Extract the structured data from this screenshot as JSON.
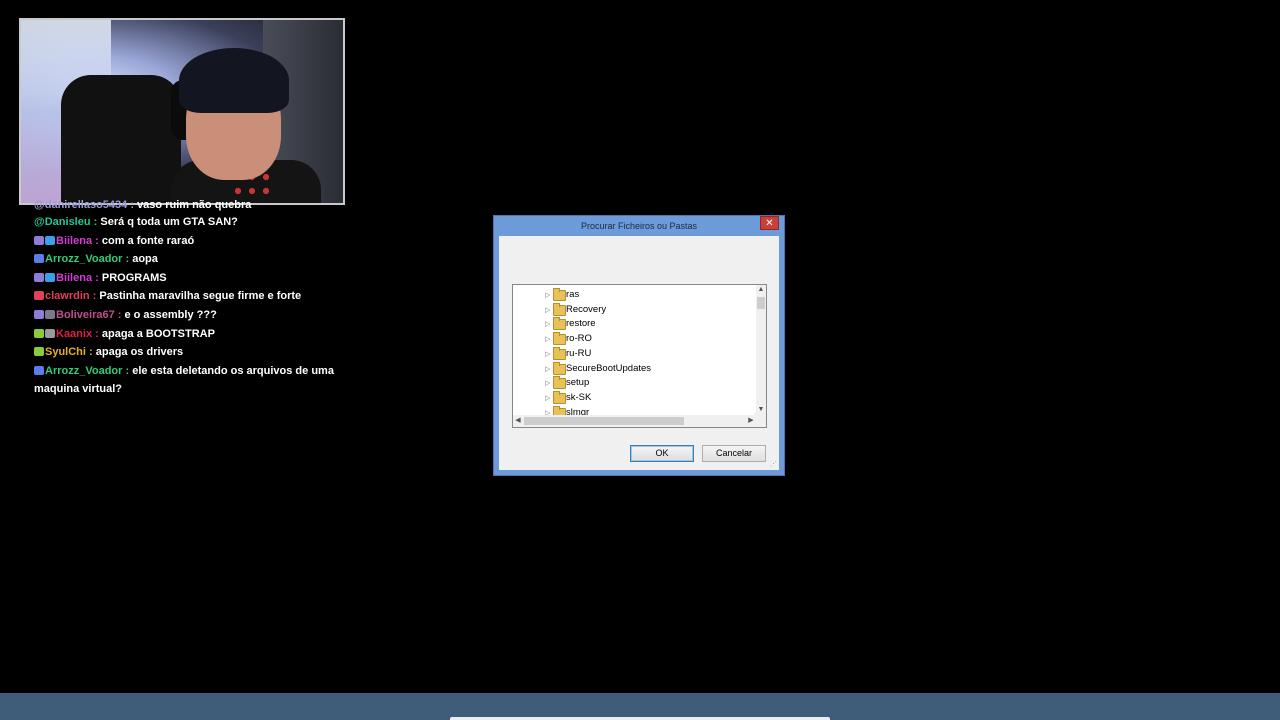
{
  "webcam": {
    "icon": "webcam-feed"
  },
  "chat": [
    {
      "user": "@danirellaso5434",
      "msg": "vaso ruim não quebra",
      "color": "#9b9bd6",
      "badges": []
    },
    {
      "user": "@Danisleu",
      "msg": "Será q toda um GTA SAN?",
      "color": "#20c997",
      "badges": []
    },
    {
      "user": "Biilena",
      "msg": "com a fonte raraó",
      "color": "#d13fd1",
      "badges": [
        "#8f7bd8",
        "#3aa0e8"
      ]
    },
    {
      "user": "Arrozz_Voador",
      "msg": "aopa",
      "color": "#33cc7a",
      "badges": [
        "#5f7be8"
      ]
    },
    {
      "user": "Biilena",
      "msg": "PROGRAMS",
      "color": "#d13fd1",
      "badges": [
        "#8f7bd8",
        "#3aa0e8"
      ]
    },
    {
      "user": "clawrdin",
      "msg": "Pastinha maravilha segue firme e forte",
      "color": "#e0405a",
      "badges": [
        "#e0405a"
      ]
    },
    {
      "user": "Boliveira67",
      "msg": "e o assembly ???",
      "color": "#c04f8c",
      "badges": [
        "#8f7bd8",
        "#7a7a8a"
      ]
    },
    {
      "user": "Kaanix",
      "msg": "apaga a BOOTSTRAP",
      "color": "#e0204a",
      "badges": [
        "#8acb3a",
        "#9a9a9a"
      ]
    },
    {
      "user": "SyulChi",
      "msg": "apaga os drivers",
      "color": "#e6b020",
      "badges": [
        "#8acb3a"
      ]
    },
    {
      "user": "Arrozz_Voador",
      "msg": "ele esta deletando os arquivos de uma maquina virtual?",
      "color": "#33cc7a",
      "badges": [
        "#5f7be8"
      ]
    }
  ],
  "dialog": {
    "title": "Procurar Ficheiros ou Pastas",
    "close": "✕",
    "ok_label": "OK",
    "cancel_label": "Cancelar",
    "folders": [
      "ras",
      "Recovery",
      "restore",
      "ro-RO",
      "ru-RU",
      "SecureBootUpdates",
      "setup",
      "sk-SK",
      "slmgr"
    ]
  }
}
